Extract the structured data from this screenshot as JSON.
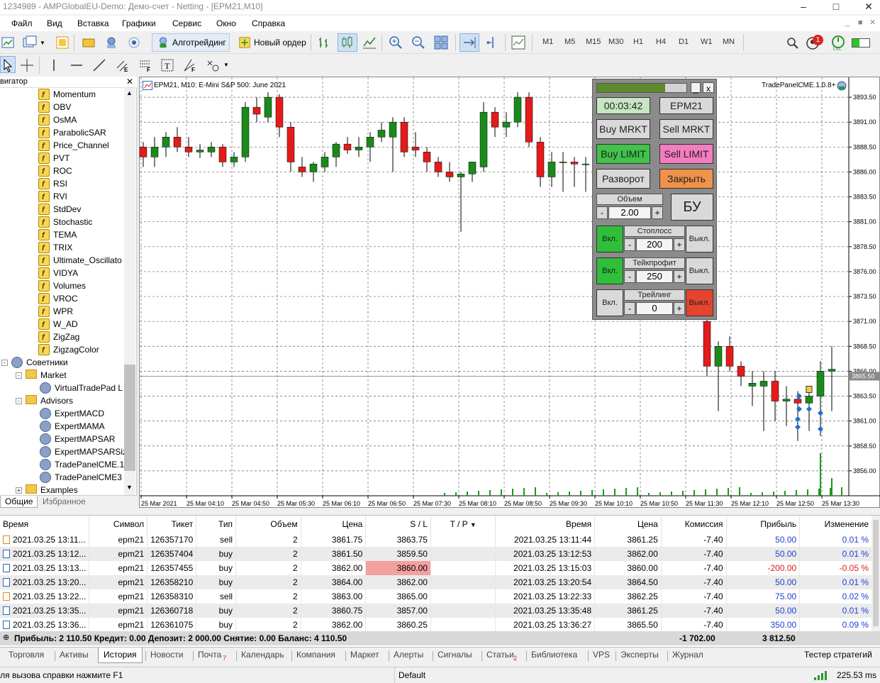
{
  "window": {
    "title": "1234989 - AMPGlobalEU-Demo: Демо-счет - Netting - [EPM21,M10]"
  },
  "menu": [
    "Файл",
    "Вид",
    "Вставка",
    "Графики",
    "Сервис",
    "Окно",
    "Справка"
  ],
  "toolbar": {
    "algo_label": "Алготрейдинг",
    "new_order_label": "Новый ордер",
    "timeframes": [
      "M1",
      "M5",
      "M15",
      "M30",
      "H1",
      "H4",
      "D1",
      "W1",
      "MN"
    ],
    "notification_count": "1",
    "lvl_label": "LVL"
  },
  "navigator": {
    "title": "Навигатор",
    "indicators": [
      "Momentum",
      "OBV",
      "OsMA",
      "ParabolicSAR",
      "Price_Channel",
      "PVT",
      "ROC",
      "RSI",
      "RVI",
      "StdDev",
      "Stochastic",
      "TEMA",
      "TRIX",
      "Ultimate_Oscillato",
      "VIDYA",
      "Volumes",
      "VROC",
      "WPR",
      "W_AD",
      "ZigZag",
      "ZigzagColor"
    ],
    "advisors_root": "Советники",
    "market_folder": "Market",
    "market_items": [
      "VirtualTradePad L"
    ],
    "advisors_folder": "Advisors",
    "advisor_items": [
      "ExpertMACD",
      "ExpertMAMA",
      "ExpertMAPSAR",
      "ExpertMAPSARSiz",
      "TradePanelCME.1.",
      "TradePanelCME3"
    ],
    "examples_folder": "Examples",
    "tabs": [
      "Общие",
      "Избранное"
    ]
  },
  "chart": {
    "header": "EPM21, M10:  E-Mini S&P 500: June 2021",
    "ea_label": "TradePanelCME.1.0.8+",
    "current_price": "3865.50",
    "price_labels": [
      "3893.50",
      "3891.00",
      "3888.50",
      "3886.00",
      "3883.50",
      "3881.00",
      "3878.50",
      "3876.00",
      "3873.50",
      "3871.00",
      "3868.50",
      "3866.00",
      "3863.50",
      "3861.00",
      "3858.50",
      "3856.00"
    ],
    "time_labels": [
      "25 Mar 2021",
      "25 Mar 04:10",
      "25 Mar 04:50",
      "25 Mar 05:30",
      "25 Mar 06:10",
      "25 Mar 06:50",
      "25 Mar 07:30",
      "25 Mar 08:10",
      "25 Mar 08:50",
      "25 Mar 09:30",
      "25 Mar 10:10",
      "25 Mar 10:50",
      "25 Mar 11:30",
      "25 Mar 12:10",
      "25 Mar 12:50",
      "25 Mar 13:30"
    ]
  },
  "chart_data": {
    "type": "candlestick",
    "symbol": "EPM21",
    "timeframe": "M10",
    "ylim": [
      3853.5,
      3895.5
    ],
    "candles": [
      [
        3888.5,
        3889.0,
        3886.5,
        3887.5
      ],
      [
        3887.5,
        3889.5,
        3886.5,
        3888.5
      ],
      [
        3888.5,
        3890.0,
        3887.5,
        3889.5
      ],
      [
        3889.5,
        3890.5,
        3888.0,
        3888.5
      ],
      [
        3888.5,
        3889.5,
        3887.5,
        3888.0
      ],
      [
        3888.0,
        3888.8,
        3887.4,
        3888.2
      ],
      [
        3888.0,
        3889.0,
        3887.5,
        3888.5
      ],
      [
        3888.5,
        3888.8,
        3886.5,
        3887.0
      ],
      [
        3887.0,
        3888.0,
        3886.5,
        3887.5
      ],
      [
        3887.5,
        3893.0,
        3887.0,
        3892.5
      ],
      [
        3892.5,
        3893.5,
        3891.0,
        3891.8
      ],
      [
        3891.5,
        3894.0,
        3891.0,
        3893.5
      ],
      [
        3893.5,
        3893.8,
        3889.5,
        3890.5
      ],
      [
        3890.5,
        3891.0,
        3886.0,
        3887.0
      ],
      [
        3886.5,
        3887.5,
        3885.5,
        3886.0
      ],
      [
        3886.0,
        3887.0,
        3885.0,
        3886.8
      ],
      [
        3886.5,
        3888.0,
        3886.0,
        3887.5
      ],
      [
        3887.5,
        3889.0,
        3886.5,
        3888.8
      ],
      [
        3888.8,
        3889.5,
        3887.8,
        3888.2
      ],
      [
        3888.2,
        3889.5,
        3887.5,
        3888.5
      ],
      [
        3888.5,
        3890.0,
        3887.0,
        3889.5
      ],
      [
        3889.5,
        3891.0,
        3889.0,
        3890.2
      ],
      [
        3889.5,
        3891.5,
        3886.0,
        3891.0
      ],
      [
        3891.0,
        3891.5,
        3887.5,
        3888.0
      ],
      [
        3888.5,
        3890.0,
        3887.5,
        3888.2
      ],
      [
        3888.0,
        3888.5,
        3886.0,
        3887.0
      ],
      [
        3887.0,
        3887.5,
        3885.5,
        3886.0
      ],
      [
        3886.0,
        3887.0,
        3885.0,
        3885.5
      ],
      [
        3885.5,
        3886.0,
        3880.0,
        3885.8
      ],
      [
        3885.8,
        3887.0,
        3885.0,
        3887.0
      ],
      [
        3886.5,
        3893.0,
        3886.0,
        3892.0
      ],
      [
        3892.0,
        3892.5,
        3889.5,
        3890.5
      ],
      [
        3890.5,
        3892.0,
        3889.5,
        3891.0
      ],
      [
        3891.0,
        3894.0,
        3890.5,
        3893.5
      ],
      [
        3893.5,
        3894.0,
        3888.5,
        3889.0
      ],
      [
        3889.0,
        3889.5,
        3884.5,
        3885.5
      ],
      [
        3885.5,
        3888.0,
        3884.5,
        3887.0
      ],
      [
        3887.0,
        3888.0,
        3884.0,
        3887.0
      ],
      [
        3887.0,
        3887.5,
        3884.5,
        3886.8
      ],
      [
        3886.8,
        3887.5,
        3884.0,
        3886.8
      ],
      [
        3886.8,
        3887.5,
        3883.5,
        3886.8
      ],
      [
        3886.5,
        3888.0,
        3885.0,
        3887.5
      ],
      [
        3887.5,
        3890.0,
        3887.0,
        3889.5
      ],
      [
        3888.5,
        3890.0,
        3887.5,
        3889.0
      ]
    ],
    "candles_right": [
      [
        3871.0,
        3871.5,
        3865.5,
        3866.5
      ],
      [
        3866.5,
        3869.0,
        3862.0,
        3868.5
      ],
      [
        3868.5,
        3869.5,
        3866.0,
        3866.5
      ],
      [
        3866.5,
        3867.0,
        3864.5,
        3865.5
      ],
      [
        3864.5,
        3866.0,
        3862.5,
        3864.8
      ],
      [
        3864.5,
        3866.0,
        3860.0,
        3865.0
      ],
      [
        3865.0,
        3866.0,
        3861.0,
        3863.0
      ],
      [
        3863.0,
        3864.5,
        3860.5,
        3863.2
      ],
      [
        3863.2,
        3864.0,
        3859.0,
        3862.8
      ],
      [
        3862.8,
        3864.5,
        3860.0,
        3863.5
      ],
      [
        3863.5,
        3867.0,
        3859.5,
        3866.0
      ],
      [
        3866.0,
        3868.5,
        3862.0,
        3866.2
      ]
    ]
  },
  "tradepanel": {
    "timer": "00:03:42",
    "symbol": "EPM21",
    "buy_market": "Buy MRKT",
    "sell_market": "Sell MRKT",
    "buy_limit": "Buy LIMIT",
    "sell_limit": "Sell LIMIT",
    "reverse": "Разворот",
    "close": "Закрыть",
    "volume_label": "Объем",
    "volume": "2.00",
    "breakeven": "БУ",
    "on": "Вкл.",
    "off": "Выкл.",
    "stoploss_label": "Стоплосс",
    "stoploss": "200",
    "takeprofit_label": "Тейкпрофит",
    "takeprofit": "250",
    "trailing_label": "Трейлинг",
    "trailing": "0",
    "minus": "-",
    "plus": "+",
    "minimize": "_",
    "close_x": "x"
  },
  "history": {
    "columns": [
      "Время",
      "Символ",
      "Тикет",
      "Тип",
      "Объем",
      "Цена",
      "S / L",
      "T / P",
      "Время",
      "Цена",
      "Комиссия",
      "Прибыль",
      "Изменение"
    ],
    "rows": [
      {
        "time": "2021.03.25 13:11...",
        "symbol": "epm21",
        "ticket": "126357170",
        "type": "sell",
        "volume": "2",
        "price": "3861.75",
        "sl": "3863.75",
        "tp": "",
        "ctime": "2021.03.25 13:11:44",
        "cprice": "3861.25",
        "commission": "-7.40",
        "profit": "50.00",
        "change": "0.01 %"
      },
      {
        "time": "2021.03.25 13:12...",
        "symbol": "epm21",
        "ticket": "126357404",
        "type": "buy",
        "volume": "2",
        "price": "3861.50",
        "sl": "3859.50",
        "tp": "",
        "ctime": "2021.03.25 13:12:53",
        "cprice": "3862.00",
        "commission": "-7.40",
        "profit": "50.00",
        "change": "0.01 %"
      },
      {
        "time": "2021.03.25 13:13...",
        "symbol": "epm21",
        "ticket": "126357455",
        "type": "buy",
        "volume": "2",
        "price": "3862.00",
        "sl": "3860.00",
        "tp": "",
        "ctime": "2021.03.25 13:15:03",
        "cprice": "3860.00",
        "commission": "-7.40",
        "profit": "-200.00",
        "change": "-0.05 %"
      },
      {
        "time": "2021.03.25 13:20...",
        "symbol": "epm21",
        "ticket": "126358210",
        "type": "buy",
        "volume": "2",
        "price": "3864.00",
        "sl": "3862.00",
        "tp": "",
        "ctime": "2021.03.25 13:20:54",
        "cprice": "3864.50",
        "commission": "-7.40",
        "profit": "50.00",
        "change": "0.01 %"
      },
      {
        "time": "2021.03.25 13:22...",
        "symbol": "epm21",
        "ticket": "126358310",
        "type": "sell",
        "volume": "2",
        "price": "3863.00",
        "sl": "3865.00",
        "tp": "",
        "ctime": "2021.03.25 13:22:33",
        "cprice": "3862.25",
        "commission": "-7.40",
        "profit": "75.00",
        "change": "0.02 %"
      },
      {
        "time": "2021.03.25 13:35...",
        "symbol": "epm21",
        "ticket": "126360718",
        "type": "buy",
        "volume": "2",
        "price": "3860.75",
        "sl": "3857.00",
        "tp": "",
        "ctime": "2021.03.25 13:35:48",
        "cprice": "3861.25",
        "commission": "-7.40",
        "profit": "50.00",
        "change": "0.01 %"
      },
      {
        "time": "2021.03.25 13:36...",
        "symbol": "epm21",
        "ticket": "126361075",
        "type": "buy",
        "volume": "2",
        "price": "3862.00",
        "sl": "3860.25",
        "tp": "",
        "ctime": "2021.03.25 13:36:27",
        "cprice": "3865.50",
        "commission": "-7.40",
        "profit": "350.00",
        "change": "0.09 %"
      }
    ],
    "summary": "Прибыль: 2 110.50  Кредит: 0.00  Депозит: 2 000.00  Снятие: 0.00  Баланс: 4 110.50",
    "commission_total": "-1 702.00",
    "profit_total": "3 812.50"
  },
  "bottom_tabs": [
    "Торговля",
    "Активы",
    "История",
    "Новости",
    "Почта",
    "Календарь",
    "Компания",
    "Маркет",
    "Алерты",
    "Сигналы",
    "Статьи",
    "Библиотека",
    "VPS",
    "Эксперты",
    "Журнал"
  ],
  "mail_badge": "7",
  "articles_badge": "2",
  "strategy_tester": "Тестер стратегий",
  "status": {
    "help": "Для вызова справки нажмите F1",
    "profile": "Default",
    "ping": "225.53 ms"
  },
  "colors": {
    "bull": "#1a8a1a",
    "bear": "#e41b1b",
    "loss_bg": "#f4a0a0",
    "profit_text": "#1f3fd0",
    "loss_text": "#e01b1b"
  }
}
